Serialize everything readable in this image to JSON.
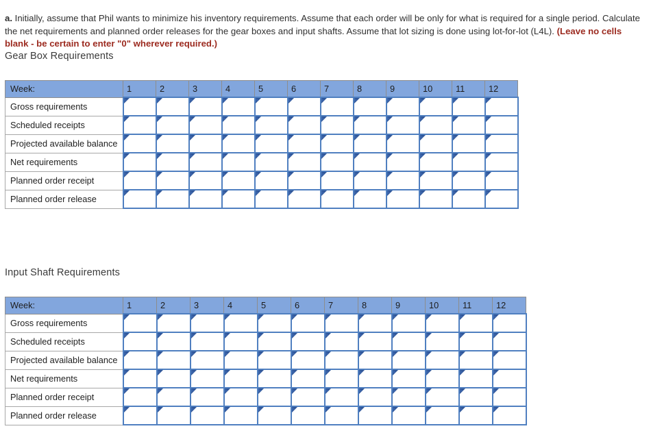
{
  "prompt": {
    "letter": "a.",
    "body": " Initially, assume that Phil wants to minimize his inventory requirements. Assume that each order will be only for what is required for a single period. Calculate the net requirements and planned order releases for the gear boxes and input shafts. Assume that lot sizing is done using lot-for-lot (L4L). ",
    "warning": "(Leave no cells blank - be certain to enter \"0\" wherever required.)"
  },
  "colors": {
    "header_blue": "#82a6dd",
    "cell_border_blue": "#4f7fc0",
    "marker_blue": "#2f5597",
    "warning_red": "#9c2b20",
    "label_border_gray": "#a7a7a7",
    "header_border_gray": "#8d8d8d"
  },
  "tables": [
    {
      "id": "gear",
      "title": "Gear Box Requirements",
      "header_label": "Week:",
      "week_columns": [
        "1",
        "2",
        "3",
        "4",
        "5",
        "6",
        "7",
        "8",
        "9",
        "10",
        "11",
        "12"
      ],
      "rows": [
        {
          "label": "Gross requirements",
          "values": [
            "",
            "",
            "",
            "",
            "",
            "",
            "",
            "",
            "",
            "",
            "",
            ""
          ]
        },
        {
          "label": "Scheduled receipts",
          "values": [
            "",
            "",
            "",
            "",
            "",
            "",
            "",
            "",
            "",
            "",
            "",
            ""
          ]
        },
        {
          "label": "Projected available balance",
          "values": [
            "",
            "",
            "",
            "",
            "",
            "",
            "",
            "",
            "",
            "",
            "",
            ""
          ]
        },
        {
          "label": "Net requirements",
          "values": [
            "",
            "",
            "",
            "",
            "",
            "",
            "",
            "",
            "",
            "",
            "",
            ""
          ]
        },
        {
          "label": "Planned order receipt",
          "values": [
            "",
            "",
            "",
            "",
            "",
            "",
            "",
            "",
            "",
            "",
            "",
            ""
          ]
        },
        {
          "label": "Planned order release",
          "values": [
            "",
            "",
            "",
            "",
            "",
            "",
            "",
            "",
            "",
            "",
            "",
            ""
          ]
        }
      ]
    },
    {
      "id": "shaft",
      "title": "Input Shaft Requirements",
      "header_label": "Week:",
      "week_columns": [
        "1",
        "2",
        "3",
        "4",
        "5",
        "6",
        "7",
        "8",
        "9",
        "10",
        "11",
        "12"
      ],
      "rows": [
        {
          "label": "Gross requirements",
          "values": [
            "",
            "",
            "",
            "",
            "",
            "",
            "",
            "",
            "",
            "",
            "",
            ""
          ]
        },
        {
          "label": "Scheduled receipts",
          "values": [
            "",
            "",
            "",
            "",
            "",
            "",
            "",
            "",
            "",
            "",
            "",
            ""
          ]
        },
        {
          "label": "Projected available balance",
          "values": [
            "",
            "",
            "",
            "",
            "",
            "",
            "",
            "",
            "",
            "",
            "",
            ""
          ]
        },
        {
          "label": "Net requirements",
          "values": [
            "",
            "",
            "",
            "",
            "",
            "",
            "",
            "",
            "",
            "",
            "",
            ""
          ]
        },
        {
          "label": "Planned order receipt",
          "values": [
            "",
            "",
            "",
            "",
            "",
            "",
            "",
            "",
            "",
            "",
            "",
            ""
          ]
        },
        {
          "label": "Planned order release",
          "values": [
            "",
            "",
            "",
            "",
            "",
            "",
            "",
            "",
            "",
            "",
            "",
            ""
          ]
        }
      ]
    }
  ],
  "layout": {
    "label_col_width": 172,
    "gear_week_col_width": 48,
    "shaft_week_col_width": 49,
    "cell_marker_icon": "cell-input-marker-triangle"
  }
}
